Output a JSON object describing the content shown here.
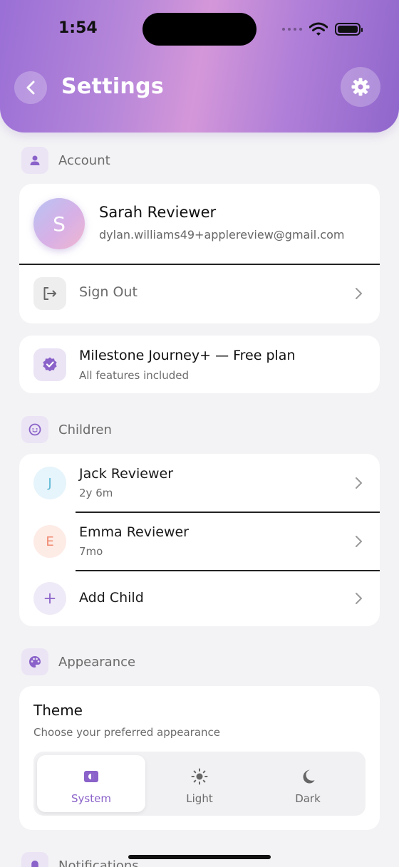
{
  "status_bar": {
    "time": "1:54"
  },
  "header": {
    "title": "Settings"
  },
  "sections": {
    "account": "Account",
    "children": "Children",
    "appearance": "Appearance",
    "notifications": "Notifications"
  },
  "account": {
    "avatar_initial": "S",
    "name": "Sarah Reviewer",
    "email": "dylan.williams49+applereview@gmail.com",
    "sign_out_label": "Sign Out"
  },
  "plan": {
    "title": "Milestone Journey+ — Free plan",
    "subtitle": "All features included"
  },
  "children": [
    {
      "initial": "J",
      "name": "Jack Reviewer",
      "age": "2y 6m",
      "color": "#5cb8d6",
      "bg": "#e6f4fb"
    },
    {
      "initial": "E",
      "name": "Emma Reviewer",
      "age": "7mo",
      "color": "#ef8a6f",
      "bg": "#fdebe6"
    }
  ],
  "add_child_label": "Add Child",
  "theme": {
    "title": "Theme",
    "subtitle": "Choose your preferred appearance",
    "options": [
      {
        "label": "System",
        "icon": "system-icon",
        "selected": true
      },
      {
        "label": "Light",
        "icon": "sun-icon",
        "selected": false
      },
      {
        "label": "Dark",
        "icon": "moon-icon",
        "selected": false
      }
    ]
  },
  "colors": {
    "accent": "#8a62c9",
    "header_start": "#9a6fd6",
    "header_end": "#8f66cc"
  }
}
